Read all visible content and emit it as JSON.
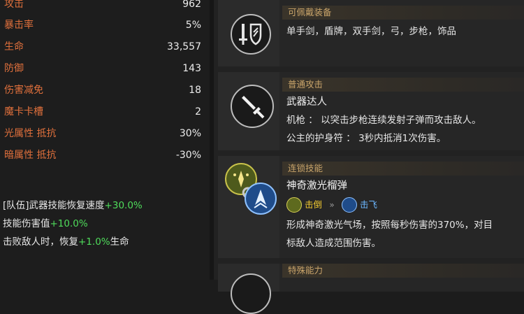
{
  "stats": [
    {
      "label": "攻击",
      "value": "962"
    },
    {
      "label": "暴击率",
      "value": "5%"
    },
    {
      "label": "生命",
      "value": "33,557"
    },
    {
      "label": "防御",
      "value": "143"
    },
    {
      "label": "伤害减免",
      "value": "18"
    },
    {
      "label": "魔卡卡槽",
      "value": "2"
    },
    {
      "label": "光属性 抵抗",
      "value": "30%"
    },
    {
      "label": "暗属性 抵抗",
      "value": "-30%"
    }
  ],
  "bonuses": [
    {
      "text": "[队伍]武器技能恢复速度",
      "green": "+30.0%",
      "suffix": ""
    },
    {
      "text": "技能伤害值",
      "green": "+10.0%",
      "suffix": ""
    },
    {
      "text": "击败敌人时，恢复",
      "green": "+1.0%",
      "suffix": "生命"
    }
  ],
  "cards": {
    "equip": {
      "header": "可佩戴装备",
      "text": "单手剑，盾牌，双手剑，弓，步枪，饰品",
      "icon": "sword-shield-icon"
    },
    "attack": {
      "header": "普通攻击",
      "name": "武器达人",
      "line1": "机枪 ： 以突击步枪连续发射子弹而攻击敌人。",
      "line2": "公主的护身符 ： 3秒内抵消1次伤害。",
      "icon": "sword-icon"
    },
    "chain": {
      "header": "连锁技能",
      "name": "神奇激光榴弹",
      "tag1": "击倒",
      "tag2": "击飞",
      "line1": "形成神奇激光气场，按照每秒伤害的370%，对目",
      "line2": "标敌人造成范围伤害。",
      "icon": "chain-skill-icon"
    },
    "special": {
      "header": "特殊能力"
    }
  },
  "colors": {
    "stat_label": "#e0703c",
    "header_text": "#c9a46a",
    "bonus_green": "#4fdc5b",
    "tag_yellow": "#f0c830",
    "tag_blue": "#6cb7ff"
  }
}
